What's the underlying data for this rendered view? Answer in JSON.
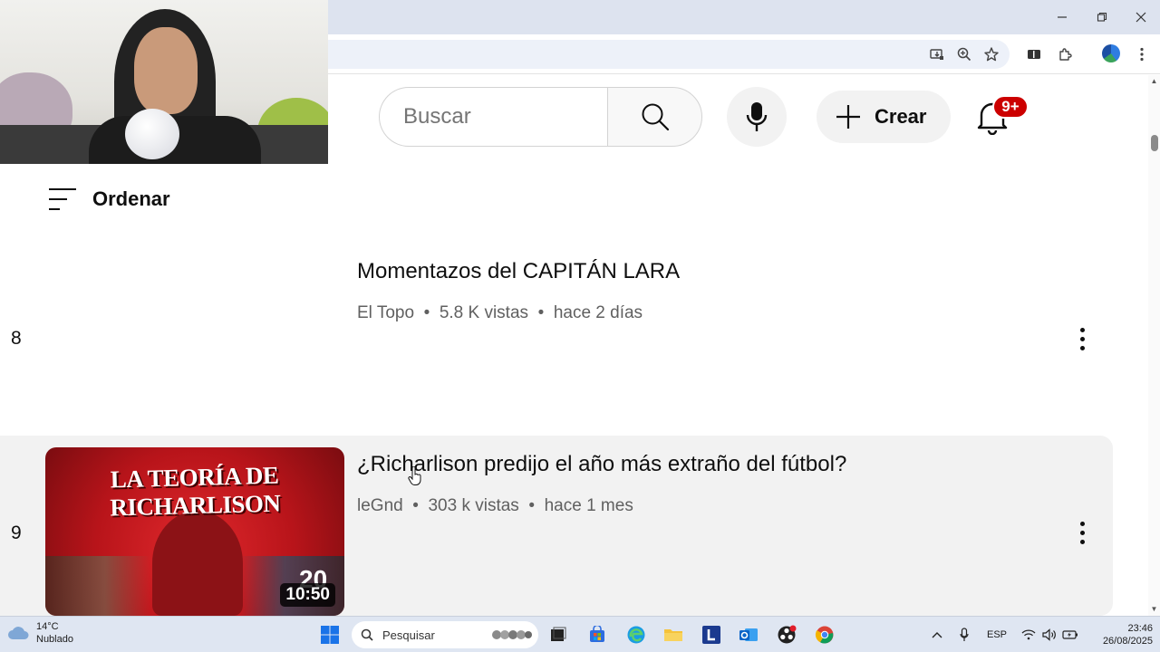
{
  "header": {
    "search_placeholder": "Buscar",
    "create_label": "Crear",
    "notifications_badge": "9+"
  },
  "sort": {
    "label": "Ordenar"
  },
  "videos": [
    {
      "index": "8",
      "title": "Momentazos del CAPITÁN LARA",
      "channel": "El Topo",
      "views": "5.8 K vistas",
      "age": "hace 2 días"
    },
    {
      "index": "9",
      "title": "¿Richarlison predijo el año más extraño del fútbol?",
      "channel": "leGnd",
      "views": "303 k vistas",
      "age": "hace 1 mes",
      "thumbnail_text": "LA TEORÍA DE RICHARLISON",
      "thumbnail_number": "20",
      "duration": "10:50"
    }
  ],
  "taskbar": {
    "weather_temp": "14°C",
    "weather_desc": "Nublado",
    "search_label": "Pesquisar",
    "language": "ESP",
    "time": "23:46",
    "date": "26/08/2025"
  },
  "colors": {
    "accent_red": "#cc0000",
    "hover_row": "#f2f2f2",
    "meta_text": "#606060"
  }
}
